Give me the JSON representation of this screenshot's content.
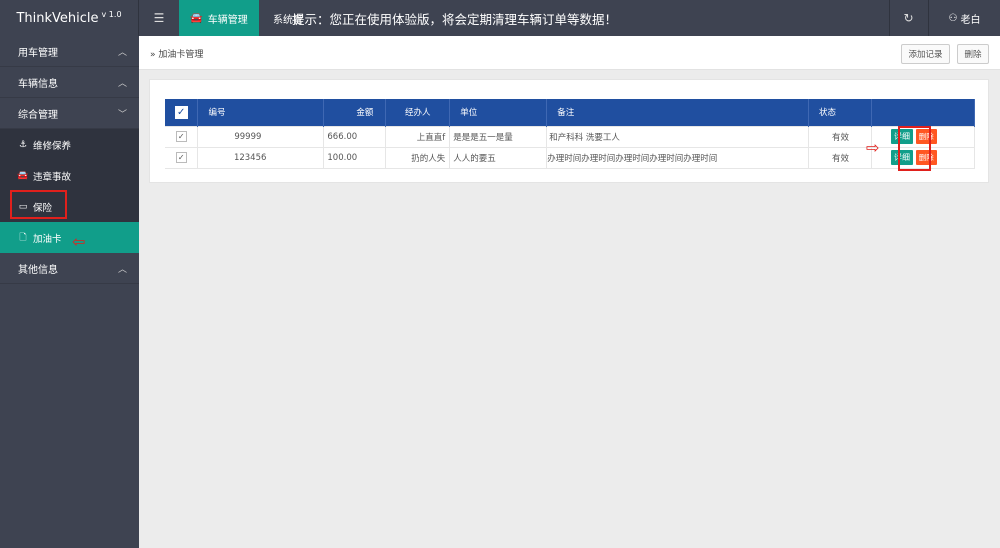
{
  "app": {
    "brand": "ThinkVehicle",
    "version": "v 1.0"
  },
  "topbar": {
    "menu_icon": "hamburger-icon",
    "active_tab": "车辆管理",
    "system_tab": "系统管",
    "notice": "提示：您正在使用体验版，将会定期清理车辆订单等数据！",
    "user_name": "老白",
    "refresh_glyph": "↻",
    "user_glyph": "⚇"
  },
  "sidebar": {
    "groups": [
      {
        "label": "用车管理",
        "chevron": "︿"
      },
      {
        "label": "车辆信息",
        "chevron": "︿"
      },
      {
        "label": "综合管理",
        "chevron": "﹀"
      }
    ],
    "sub_items": [
      {
        "label": "维修保养",
        "icon": "anchor-icon",
        "glyph": "⚓"
      },
      {
        "label": "违章事故",
        "icon": "car-icon",
        "glyph": "🚘"
      },
      {
        "label": "保险",
        "icon": "card-icon",
        "glyph": "▭"
      },
      {
        "label": "加油卡",
        "icon": "file-icon",
        "glyph": "🗋"
      }
    ],
    "other": {
      "label": "其他信息",
      "chevron": "︿"
    }
  },
  "breadcrumb": {
    "glyph": "»",
    "label": "加油卡管理"
  },
  "toolbar": {
    "add_label": "添加记录",
    "delete_label": "删除"
  },
  "table": {
    "headers": [
      "编号",
      "金额",
      "经办人",
      "单位",
      "备注",
      "状态",
      ""
    ],
    "rows": [
      {
        "id": "99999",
        "amount": "666.00",
        "handler": "上直直f",
        "unit": "是是是五一是量",
        "note": "和产科科 洗要工人",
        "status": "有效",
        "detail": "详细",
        "delete": "删除"
      },
      {
        "id": "123456",
        "amount": "100.00",
        "handler": "扔的人失",
        "unit": "人人的要五",
        "note": "办理时间办理时间办理时间办理时间办理时间",
        "status": "有效",
        "detail": "详细",
        "delete": "删除"
      }
    ]
  },
  "colors": {
    "topbar": "#3e4351",
    "accent": "#119e8a",
    "table_header": "#204fa0",
    "delete": "#ff5722",
    "annotation": "#e0201c"
  }
}
